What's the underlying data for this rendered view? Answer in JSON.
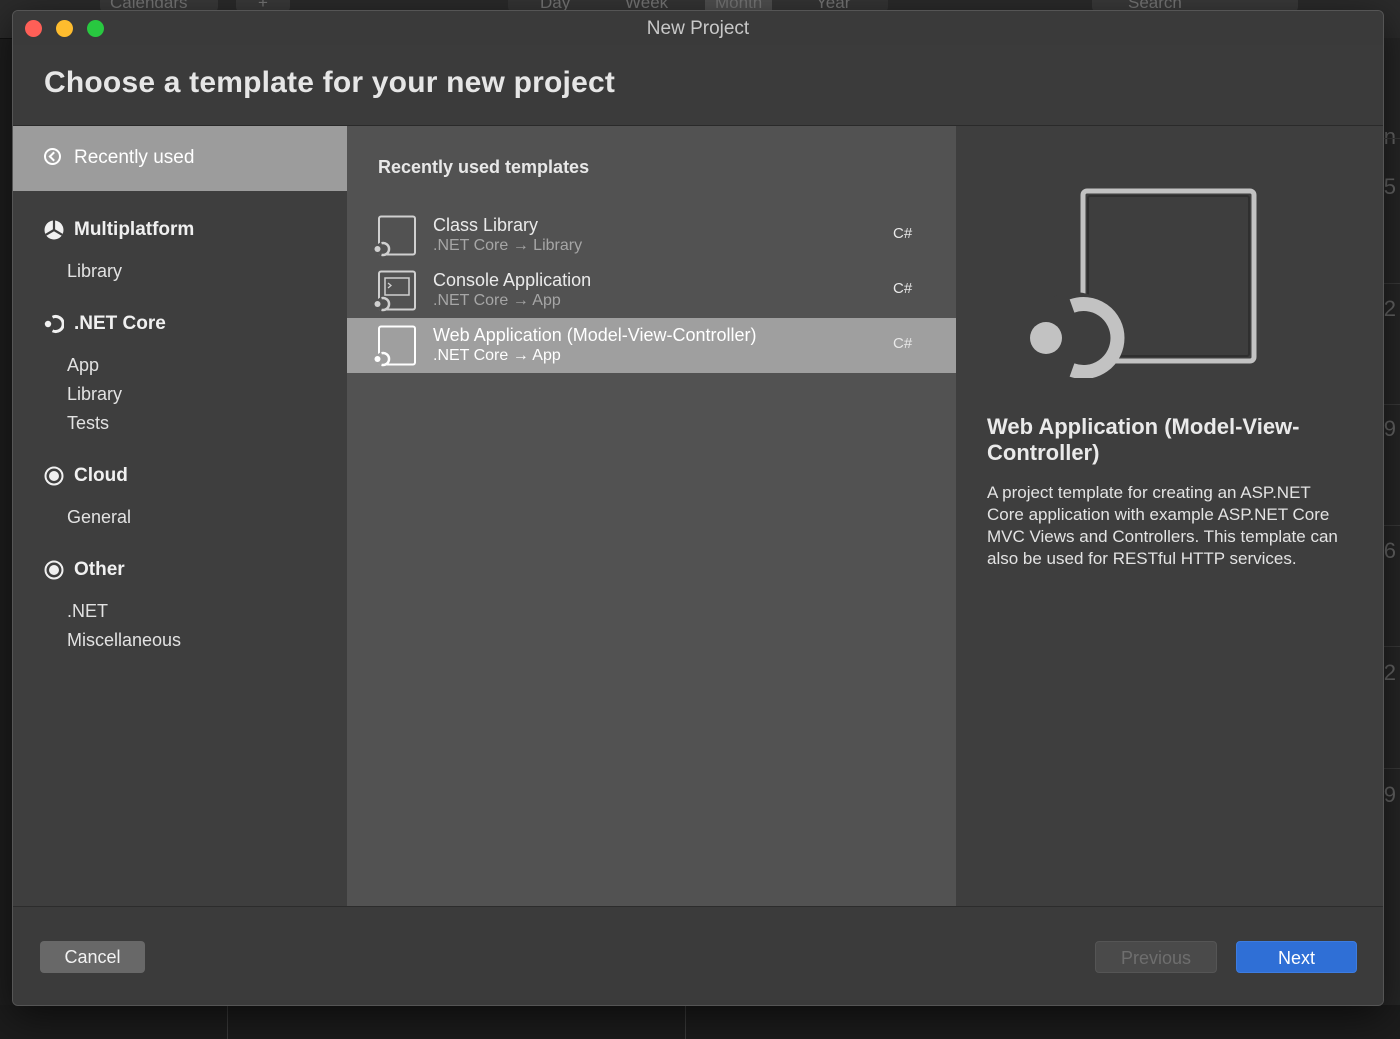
{
  "background": {
    "toolbar_labels": [
      "Calendars",
      "+",
      "Day",
      "Week",
      "Month",
      "Year",
      "Search"
    ],
    "edge_numbers": [
      "n",
      "5",
      "2",
      "9",
      "6",
      "2",
      "9"
    ]
  },
  "window": {
    "title": "New Project"
  },
  "header": {
    "title": "Choose a template for your new project"
  },
  "sidebar": {
    "selected_label": "Recently used",
    "categories": [
      {
        "label": "Multiplatform",
        "icon": "multiplatform-icon",
        "items": [
          "Library"
        ]
      },
      {
        "label": ".NET Core",
        "icon": "dotnet-core-icon",
        "items": [
          "App",
          "Library",
          "Tests"
        ]
      },
      {
        "label": "Cloud",
        "icon": "cloud-icon",
        "items": [
          "General"
        ]
      },
      {
        "label": "Other",
        "icon": "other-icon",
        "items": [
          ".NET",
          "Miscellaneous"
        ]
      }
    ]
  },
  "templates": {
    "title": "Recently used templates",
    "items": [
      {
        "name": "Class Library",
        "meta": ".NET Core → Library",
        "lang": "C#",
        "selected": false
      },
      {
        "name": "Console Application",
        "meta": ".NET Core → App",
        "lang": "C#",
        "selected": false
      },
      {
        "name": "Web Application (Model-View-Controller)",
        "meta": ".NET Core → App",
        "lang": "C#",
        "selected": true
      }
    ]
  },
  "detail": {
    "title": "Web Application (Model-View-Controller)",
    "description": "A project template for creating an ASP.NET Core application with example ASP.NET Core MVC Views and Controllers. This template can also be used for RESTful HTTP services."
  },
  "footer": {
    "cancel_label": "Cancel",
    "previous_label": "Previous",
    "next_label": "Next"
  },
  "colors": {
    "accent": "#2f6fd6",
    "selected_row": "#9f9f9f"
  }
}
